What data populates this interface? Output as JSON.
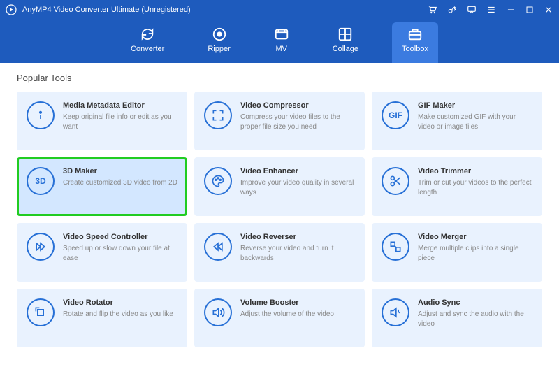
{
  "window": {
    "title": "AnyMP4 Video Converter Ultimate (Unregistered)"
  },
  "nav": {
    "items": [
      {
        "label": "Converter"
      },
      {
        "label": "Ripper"
      },
      {
        "label": "MV"
      },
      {
        "label": "Collage"
      },
      {
        "label": "Toolbox"
      }
    ]
  },
  "section_title": "Popular Tools",
  "tools": [
    {
      "icon": "i",
      "title": "Media Metadata Editor",
      "desc": "Keep original file info or edit as you want"
    },
    {
      "icon": "compress",
      "title": "Video Compressor",
      "desc": "Compress your video files to the proper file size you need"
    },
    {
      "icon": "GIF",
      "title": "GIF Maker",
      "desc": "Make customized GIF with your video or image files"
    },
    {
      "icon": "3D",
      "title": "3D Maker",
      "desc": "Create customized 3D video from 2D"
    },
    {
      "icon": "palette",
      "title": "Video Enhancer",
      "desc": "Improve your video quality in several ways"
    },
    {
      "icon": "scissors",
      "title": "Video Trimmer",
      "desc": "Trim or cut your videos to the perfect length"
    },
    {
      "icon": "ffwd",
      "title": "Video Speed Controller",
      "desc": "Speed up or slow down your file at ease"
    },
    {
      "icon": "rev",
      "title": "Video Reverser",
      "desc": "Reverse your video and turn it backwards"
    },
    {
      "icon": "merge",
      "title": "Video Merger",
      "desc": "Merge multiple clips into a single piece"
    },
    {
      "icon": "rotate",
      "title": "Video Rotator",
      "desc": "Rotate and flip the video as you like"
    },
    {
      "icon": "volume",
      "title": "Volume Booster",
      "desc": "Adjust the volume of the video"
    },
    {
      "icon": "sync",
      "title": "Audio Sync",
      "desc": "Adjust and sync the audio with the video"
    }
  ]
}
